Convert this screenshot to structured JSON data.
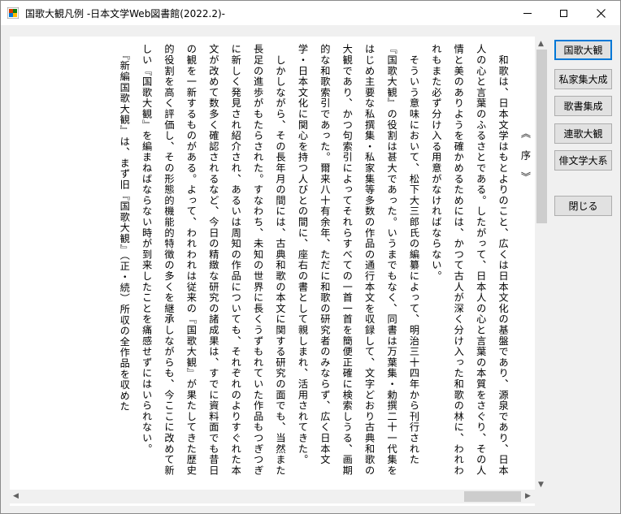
{
  "window": {
    "title": "国歌大観凡例 -日本文学Web図書館(2022.2)-"
  },
  "sidebar": {
    "buttons": [
      {
        "label": "国歌大観"
      },
      {
        "label": "私家集大成"
      },
      {
        "label": "歌書集成"
      },
      {
        "label": "連歌大観"
      },
      {
        "label": "俳文学大系"
      }
    ],
    "close_label": "閉じる"
  },
  "document": {
    "heading": "《　序　》",
    "paragraphs": [
      "　和歌は、日本文学はもとよりのこと、広くは日本文化の基盤であり、源泉であり、日本人の心と言葉のふるさとである。したがって、日本人の心と言葉の本質をさぐり、その人情と美のありようを確かめるためには、かつて古人が深く分け入った和歌の林に、われわれもまた必ず分け入る用意がなければならない。",
      "　そういう意味において、松下大三郎氏の編纂によって、明治三十四年から刊行された『国歌大観』の役割は甚大であった。いうまでもなく、同書は万葉集・勅撰二十一代集をはじめ主要な私撰集・私家集等多数の作品の通行本文を収録して、文字どおり古典和歌の大観であり、かつ句索引によってそれらすべての一首一首を簡便正確に検索しうる、画期的な和歌索引であった。爾来八十有余年、ただに和歌の研究者のみならず、広く日本文学・日本文化に関心を持つ人びとの間に、座右の書として親しまれ、活用されてきた。",
      "　しかしながら、その長年月の間には、古典和歌の本文に関する研究の面でも、当然また長足の進歩がもたらされた。すなわち、未知の世界に長くうずもれていた作品もつぎつぎに新しく発見され紹介され、あるいは周知の作品についても、それぞれのよりすぐれた本文が改めて数多く確認されるなど、今日の精緻な研究の諸成果は、すでに資料面でも昔日の観を一新するものがある。よって、われわれは従来の『国歌大観』が果たしてきた歴史的役割を高く評価し、その形態的機能的特徴の多くを継承しながらも、今ここに改めて新しい『国歌大観』を編まねばならない時が到来したことを痛感せずにはいられない。",
      "　『新編国歌大観』は、まず旧『国歌大観』（正・続）所収の全作品を収めた"
    ]
  }
}
